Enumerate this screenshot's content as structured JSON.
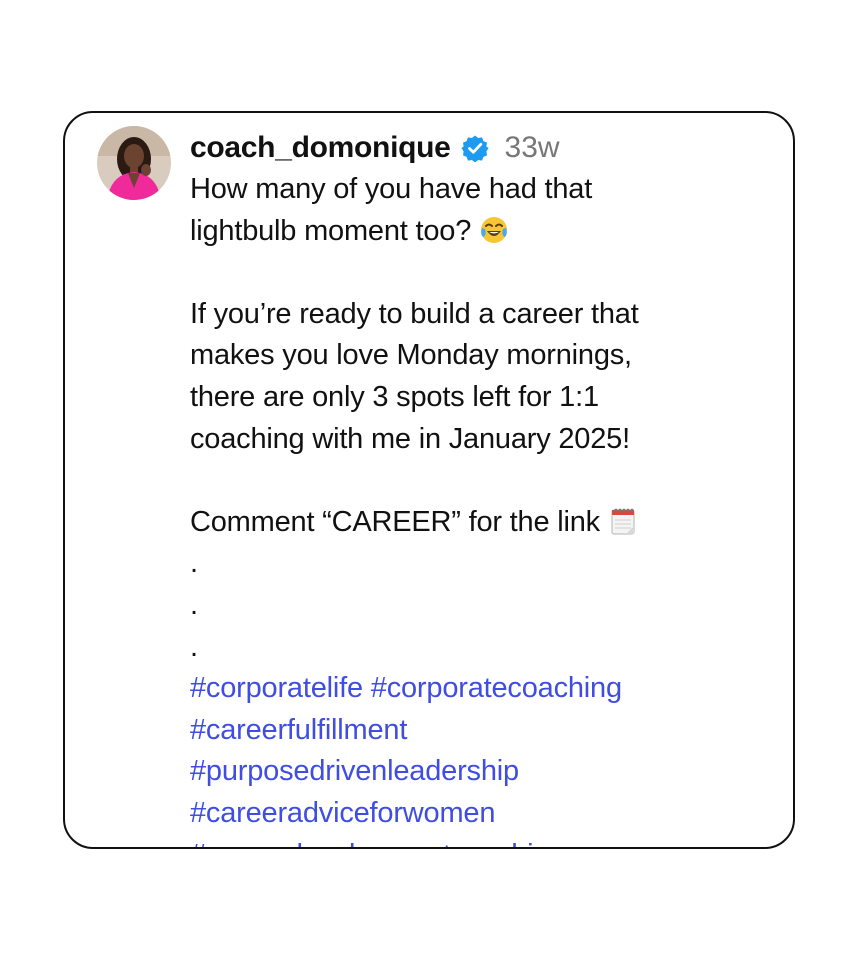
{
  "post": {
    "username": "coach_domonique",
    "time_ago": "33w",
    "verified": true,
    "verified_color": "#1d9bf0",
    "avatar_icon": "profile-photo-woman-pink-blazer",
    "caption": {
      "p1_line1": "How many of you have had that",
      "p1_line2": "lightbulb moment too?",
      "p1_emoji": "face-with-tears-of-joy",
      "p2_line1": "If you’re ready to build a career that",
      "p2_line2": "makes you love Monday mornings,",
      "p2_line3": "there are only 3 spots left for 1:1",
      "p2_line4": "coaching with me in January 2025!",
      "p3_line1": "Comment “CAREER” for the link",
      "p3_emoji": "spiral-notepad",
      "dots": [
        ".",
        ".",
        "."
      ]
    },
    "hashtags": [
      "#corporatelife #corporatecoaching",
      "#careerfulfillment",
      "#purposedrivenleadership",
      "#careeradviceforwomen",
      "#careerdevelopmentcoaching"
    ],
    "hashtag_color": "#3f4de2"
  }
}
